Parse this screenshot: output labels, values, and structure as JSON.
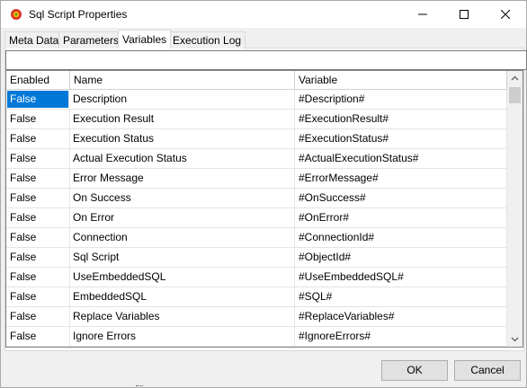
{
  "window": {
    "title": "Sql Script Properties"
  },
  "tabs": [
    {
      "label": "Meta Data",
      "active": false
    },
    {
      "label": "Parameters",
      "active": false
    },
    {
      "label": "Variables",
      "active": true
    },
    {
      "label": "Execution Log",
      "active": false
    }
  ],
  "filter": {
    "value": ""
  },
  "grid": {
    "columns": [
      "Enabled",
      "Name",
      "Variable"
    ],
    "rows": [
      {
        "enabled": "False",
        "name": "Description",
        "variable": "#Description#"
      },
      {
        "enabled": "False",
        "name": "Execution Result",
        "variable": "#ExecutionResult#"
      },
      {
        "enabled": "False",
        "name": "Execution Status",
        "variable": "#ExecutionStatus#"
      },
      {
        "enabled": "False",
        "name": "Actual Execution Status",
        "variable": "#ActualExecutionStatus#"
      },
      {
        "enabled": "False",
        "name": "Error Message",
        "variable": "#ErrorMessage#"
      },
      {
        "enabled": "False",
        "name": "On Success",
        "variable": "#OnSuccess#"
      },
      {
        "enabled": "False",
        "name": "On Error",
        "variable": "#OnError#"
      },
      {
        "enabled": "False",
        "name": "Connection",
        "variable": "#ConnectionId#"
      },
      {
        "enabled": "False",
        "name": "Sql Script",
        "variable": "#ObjectId#"
      },
      {
        "enabled": "False",
        "name": "UseEmbeddedSQL",
        "variable": "#UseEmbeddedSQL#"
      },
      {
        "enabled": "False",
        "name": "EmbeddedSQL",
        "variable": "#SQL#"
      },
      {
        "enabled": "False",
        "name": "Replace Variables",
        "variable": "#ReplaceVariables#"
      },
      {
        "enabled": "False",
        "name": "Ignore Errors",
        "variable": "#IgnoreErrors#"
      }
    ]
  },
  "buttons": {
    "ok": "OK",
    "cancel": "Cancel"
  },
  "icons": {
    "app": "sql-script-app-icon",
    "minimize": "minimize-icon",
    "maximize": "maximize-icon",
    "close": "close-icon",
    "scroll_up": "chevron-up-icon",
    "scroll_down": "chevron-down-icon"
  },
  "colors": {
    "selection": "#0078d7",
    "window_bg": "#f0f0f0"
  }
}
